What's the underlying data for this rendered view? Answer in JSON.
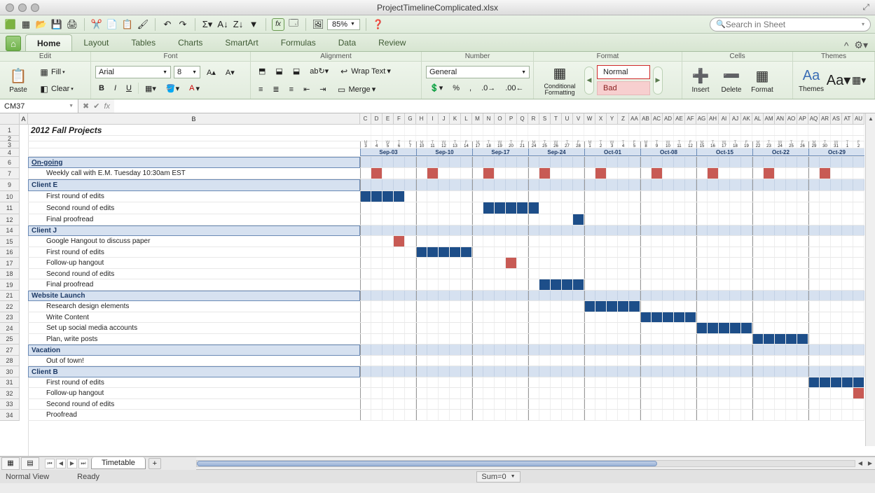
{
  "window": {
    "title": "ProjectTimelineComplicated.xlsx"
  },
  "qat": {
    "zoom": "85%",
    "search_placeholder": "Search in Sheet"
  },
  "tabs": [
    "Home",
    "Layout",
    "Tables",
    "Charts",
    "SmartArt",
    "Formulas",
    "Data",
    "Review"
  ],
  "ribbon_groups": [
    "Edit",
    "Font",
    "Alignment",
    "Number",
    "Format",
    "Cells",
    "Themes"
  ],
  "ribbon": {
    "paste": "Paste",
    "fill": "Fill",
    "clear": "Clear",
    "font_name": "Arial",
    "font_size": "8",
    "wrap": "Wrap Text",
    "merge": "Merge",
    "number_format": "General",
    "cond_fmt": "Conditional Formatting",
    "style_normal": "Normal",
    "style_bad": "Bad",
    "insert": "Insert",
    "delete": "Delete",
    "format": "Format",
    "themes": "Themes"
  },
  "namebox": "CM37",
  "formula": "",
  "columns_small": [
    "C",
    "D",
    "E",
    "F",
    "G",
    "H",
    "I",
    "J",
    "K",
    "L",
    "M",
    "N",
    "O",
    "P",
    "Q",
    "R",
    "S",
    "T",
    "U",
    "V",
    "W",
    "X",
    "Y",
    "Z",
    "AA",
    "AB",
    "AC",
    "AD",
    "AE",
    "AF",
    "AG",
    "AH",
    "AI",
    "AJ",
    "AK",
    "AL",
    "AM",
    "AN",
    "AO",
    "AP",
    "AQ",
    "AR",
    "AS",
    "AT",
    "AU"
  ],
  "day_labels_pattern": [
    "M",
    "T",
    "W",
    "T",
    "F"
  ],
  "day_numbers": [
    "3",
    "4",
    "5",
    "6",
    "7",
    "10",
    "11",
    "12",
    "13",
    "14",
    "17",
    "18",
    "19",
    "20",
    "21",
    "24",
    "25",
    "26",
    "27",
    "28",
    "1",
    "2",
    "3",
    "4",
    "5",
    "8",
    "9",
    "10",
    "11",
    "12",
    "15",
    "16",
    "17",
    "18",
    "19",
    "22",
    "23",
    "24",
    "25",
    "26",
    "29",
    "30",
    "31",
    "1",
    "2"
  ],
  "week_headers": [
    "Sep-03",
    "Sep-10",
    "Sep-17",
    "Sep-24",
    "Oct-01",
    "Oct-08",
    "Oct-15",
    "Oct-22",
    "Oct-29"
  ],
  "rows": [
    {
      "n": 1,
      "h": 16,
      "type": "title",
      "text": "2012 Fall Projects",
      "gantt": "blank-noweek"
    },
    {
      "n": 2,
      "h": 8,
      "type": "blank",
      "text": "",
      "gantt": "blank-noweek"
    },
    {
      "n": 3,
      "h": 10,
      "type": "daynums",
      "text": "",
      "gantt": "daynums"
    },
    {
      "n": 4,
      "h": 12,
      "type": "weekhdr",
      "text": "",
      "gantt": "weekhdr"
    },
    {
      "n": 6,
      "h": 16,
      "type": "header",
      "text": "On-going",
      "gantt": "headerbg"
    },
    {
      "n": 7,
      "h": 16,
      "type": "item2",
      "text": "Weekly call with E.M. Tuesday 10:30am EST",
      "gantt": "row",
      "red": [
        1,
        6,
        11,
        16,
        21,
        26,
        31,
        36,
        41
      ]
    },
    {
      "n": 9,
      "h": 17,
      "type": "header",
      "text": "Client E",
      "gantt": "headerbg"
    },
    {
      "n": 10,
      "h": 16,
      "type": "item2",
      "text": "First round of edits",
      "gantt": "row",
      "blue": [
        0,
        1,
        2,
        3
      ]
    },
    {
      "n": 11,
      "h": 17,
      "type": "item2",
      "text": "Second round of edits",
      "gantt": "row",
      "blue": [
        11,
        12,
        13,
        14,
        15
      ]
    },
    {
      "n": 12,
      "h": 16,
      "type": "item2",
      "text": "Final proofread",
      "gantt": "row",
      "blue": [
        19
      ]
    },
    {
      "n": 14,
      "h": 15,
      "type": "header",
      "text": "Client J",
      "gantt": "headerbg"
    },
    {
      "n": 15,
      "h": 16,
      "type": "item2",
      "text": "Google Hangout to discuss paper",
      "gantt": "row",
      "red": [
        3
      ]
    },
    {
      "n": 16,
      "h": 15,
      "type": "item2",
      "text": "First round of edits",
      "gantt": "row",
      "blue": [
        5,
        6,
        7,
        8,
        9
      ]
    },
    {
      "n": 17,
      "h": 16,
      "type": "item2",
      "text": "Follow-up hangout",
      "gantt": "row",
      "red": [
        13
      ]
    },
    {
      "n": 18,
      "h": 15,
      "type": "item2",
      "text": "Second round of edits",
      "gantt": "row"
    },
    {
      "n": 19,
      "h": 16,
      "type": "item2",
      "text": "Final proofread",
      "gantt": "row",
      "blue": [
        16,
        17,
        18,
        19
      ]
    },
    {
      "n": 21,
      "h": 15,
      "type": "header",
      "text": "Website Launch",
      "gantt": "headerbg"
    },
    {
      "n": 22,
      "h": 16,
      "type": "item2",
      "text": "Research design elements",
      "gantt": "row",
      "blue": [
        20,
        21,
        22,
        23,
        24
      ]
    },
    {
      "n": 23,
      "h": 15,
      "type": "item2",
      "text": "Write Content",
      "gantt": "row",
      "blue": [
        25,
        26,
        27,
        28,
        29
      ]
    },
    {
      "n": 24,
      "h": 16,
      "type": "item2",
      "text": "Set up social media accounts",
      "gantt": "row",
      "blue": [
        30,
        31,
        32,
        33,
        34
      ]
    },
    {
      "n": 25,
      "h": 15,
      "type": "item2",
      "text": "Plan, write  posts",
      "gantt": "row",
      "blue": [
        35,
        36,
        37,
        38,
        39
      ]
    },
    {
      "n": 27,
      "h": 16,
      "type": "header",
      "text": "Vacation",
      "gantt": "headerbg"
    },
    {
      "n": 28,
      "h": 15,
      "type": "item2",
      "text": "Out of town!",
      "gantt": "row"
    },
    {
      "n": 30,
      "h": 16,
      "type": "header",
      "text": "Client B",
      "gantt": "headerbg"
    },
    {
      "n": 31,
      "h": 15,
      "type": "item2",
      "text": "First round of edits",
      "gantt": "row",
      "blue": [
        40,
        41,
        42,
        43,
        44
      ]
    },
    {
      "n": 32,
      "h": 16,
      "type": "item2",
      "text": "Follow-up hangout",
      "gantt": "row",
      "red": [
        44
      ]
    },
    {
      "n": 33,
      "h": 15,
      "type": "item2",
      "text": "Second round of edits",
      "gantt": "row"
    },
    {
      "n": 34,
      "h": 16,
      "type": "item2",
      "text": "Proofread",
      "gantt": "row"
    }
  ],
  "sheet_tab": "Timetable",
  "status": {
    "view": "Normal View",
    "ready": "Ready",
    "sum": "Sum=0"
  }
}
